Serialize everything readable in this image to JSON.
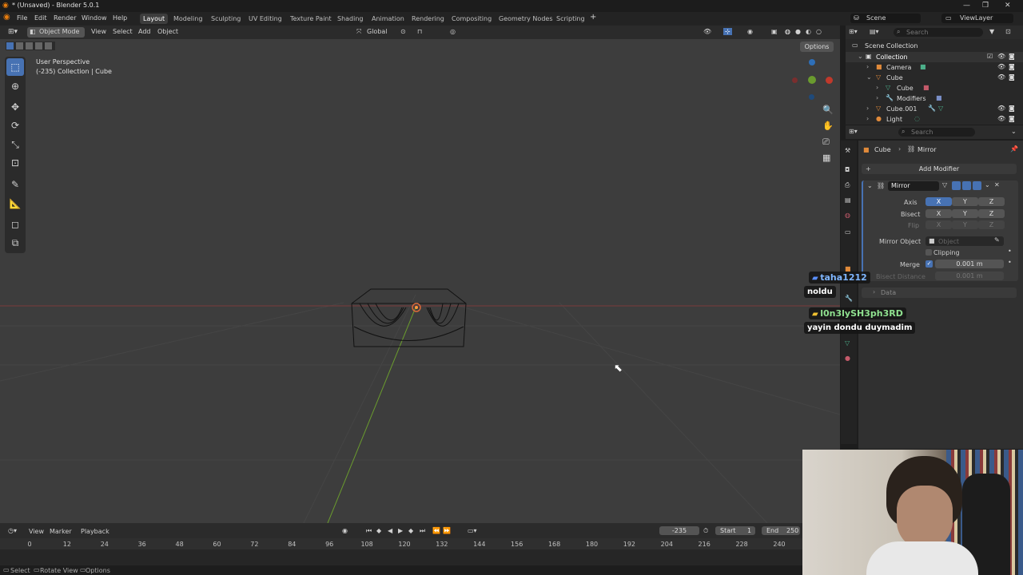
{
  "window": {
    "title": "* (Unsaved) - Blender 5.0.1",
    "controls": [
      "—",
      "❐",
      "✕"
    ]
  },
  "menu": {
    "items": [
      "File",
      "Edit",
      "Render",
      "Window",
      "Help"
    ]
  },
  "workspaces": [
    "Layout",
    "Modeling",
    "Sculpting",
    "UV Editing",
    "Texture Paint",
    "Shading",
    "Animation",
    "Rendering",
    "Compositing",
    "Geometry Nodes",
    "Scripting"
  ],
  "workspace_add": "+",
  "scene": {
    "label": "Scene",
    "view_layer": "ViewLayer"
  },
  "viewport_header": {
    "mode": "Object Mode",
    "menus": [
      "View",
      "Select",
      "Add",
      "Object"
    ],
    "orientation": "Global",
    "options": "Options"
  },
  "viewport": {
    "perspective": "User Perspective",
    "info": "(-235) Collection | Cube",
    "cursor": "⬉"
  },
  "outliner": {
    "search_placeholder": "Search",
    "root": "Scene Collection",
    "rows": [
      {
        "label": "Collection"
      },
      {
        "label": "Camera"
      },
      {
        "label": "Cube"
      },
      {
        "label": "Cube"
      },
      {
        "label": "Modifiers"
      },
      {
        "label": "Cube.001"
      },
      {
        "label": "Light"
      }
    ]
  },
  "properties": {
    "search_placeholder": "Search",
    "breadcrumb": {
      "object": "Cube",
      "modifier": "Mirror"
    },
    "add_modifier": "Add Modifier",
    "modifier_name": "Mirror",
    "axis": {
      "label": "Axis",
      "x": "X",
      "y": "Y",
      "z": "Z"
    },
    "bisect": {
      "label": "Bisect",
      "x": "X",
      "y": "Y",
      "z": "Z"
    },
    "flip": {
      "label": "Flip",
      "x": "X",
      "y": "Y",
      "z": "Z"
    },
    "mirror_object": {
      "label": "Mirror Object",
      "placeholder": "Object"
    },
    "clipping": "Clipping",
    "merge": {
      "label": "Merge",
      "value": "0.001 m"
    },
    "bisect_distance": {
      "label": "Bisect Distance",
      "value": "0.001 m"
    },
    "data": "Data"
  },
  "timeline": {
    "menus": [
      "View",
      "Marker",
      "Playback"
    ],
    "current_frame": "-235",
    "start_label": "Start",
    "start": "1",
    "end_label": "End",
    "end": "250",
    "ticks": [
      "0",
      "12",
      "24",
      "36",
      "48",
      "60",
      "72",
      "84",
      "96",
      "108",
      "120",
      "132",
      "144",
      "156",
      "168",
      "180",
      "192",
      "204",
      "216",
      "228",
      "240"
    ]
  },
  "statusbar": {
    "select": "Select",
    "rotate": "Rotate View",
    "options": "Options"
  },
  "chat": [
    {
      "user": "taha1212",
      "message": "noldu"
    },
    {
      "user": "l0n3lySH3ph3RD",
      "message": "yayin dondu duymadim"
    }
  ],
  "colors": {
    "accent": "#4772b3",
    "x_axis": "#c0392b",
    "y_axis": "#6a9b2e",
    "z_axis": "#2e6fb8"
  }
}
